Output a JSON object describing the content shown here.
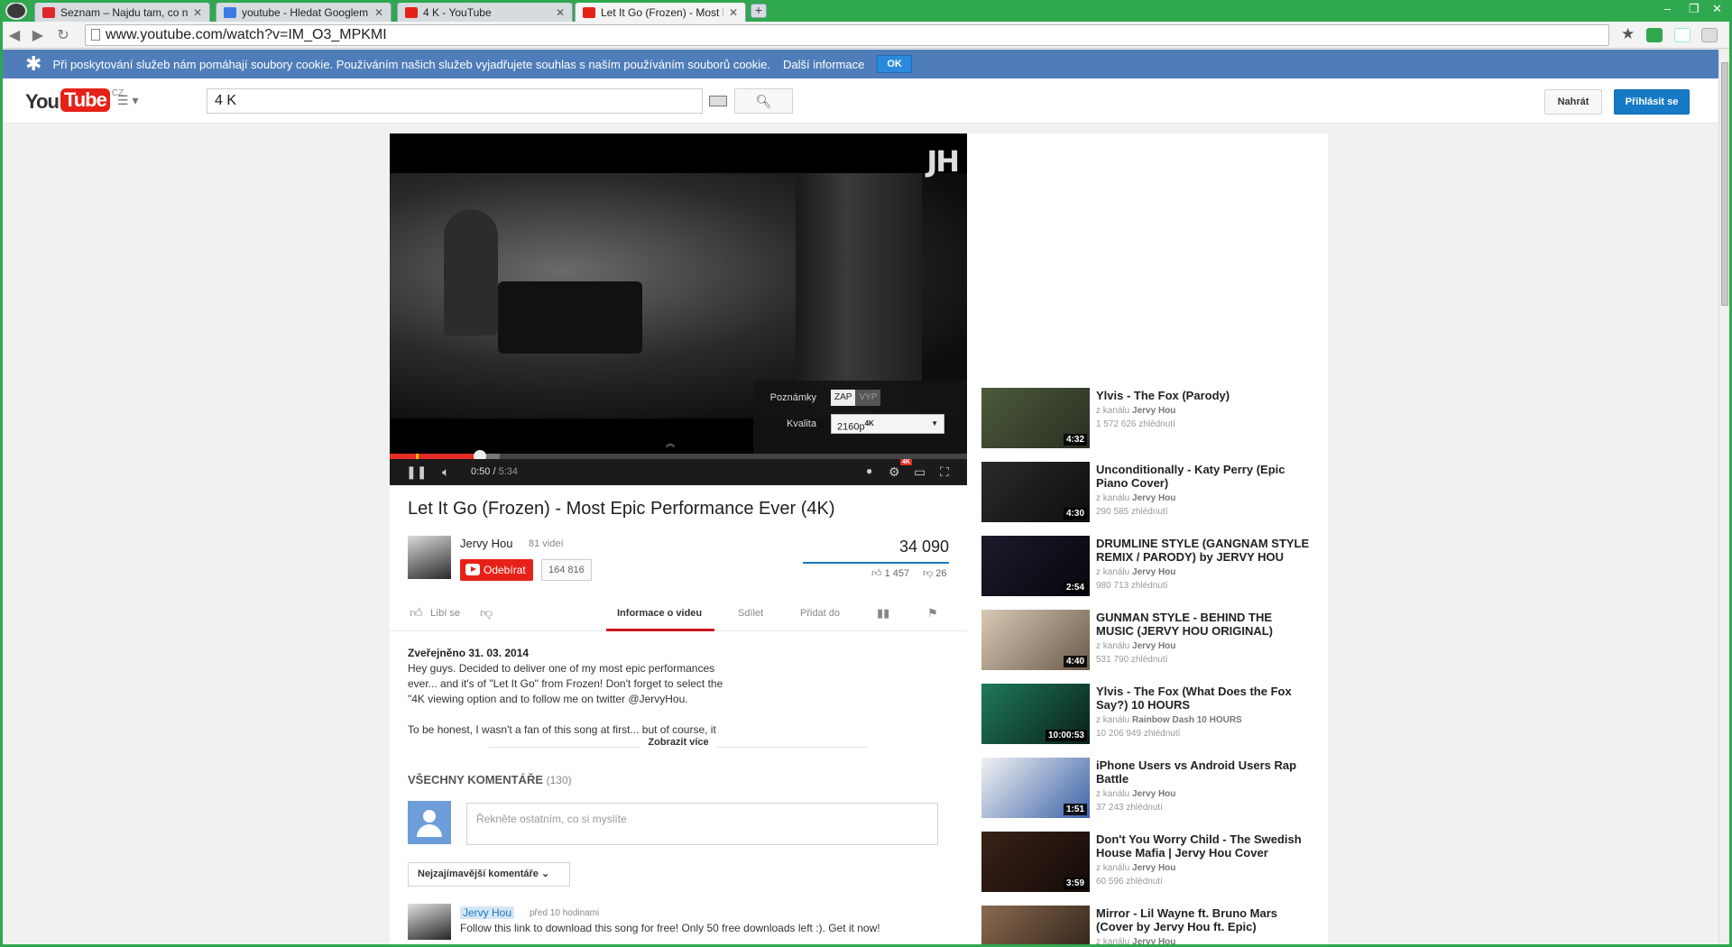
{
  "browser": {
    "tabs": [
      {
        "title": "Seznam – Najdu tam, co nez",
        "favicon_color": "#e0262b"
      },
      {
        "title": "youtube - Hledat Googlem",
        "favicon_color": "#3b7be4"
      },
      {
        "title": "4 K - YouTube",
        "favicon_color": "#e62117"
      },
      {
        "title": "Let It Go (Frozen) - Most Epi",
        "favicon_color": "#e62117",
        "active": true
      }
    ],
    "close_glyph": "✕",
    "new_tab": "+",
    "window_controls": [
      "–",
      "❐",
      "✕"
    ],
    "url": "www.youtube.com/watch?v=IM_O3_MPKMI",
    "frame_color": "#2fa84f"
  },
  "cookie_bar": {
    "message": "Při poskytování služeb nám pomáhají soubory cookie. Používáním našich služeb vyjadřujete souhlas s naším používáním souborů cookie.",
    "more": "Další informace",
    "ok": "OK"
  },
  "header": {
    "logo_you": "You",
    "logo_tube": "Tube",
    "logo_country": "CZ",
    "search_value": "4 K",
    "upload": "Nahrát",
    "signin": "Přihlásit se"
  },
  "player": {
    "watermark": "JH",
    "annotations_label": "Poznámky",
    "annotations_on": "ZAP",
    "annotations_off": "VYP",
    "quality_label": "Kvalita",
    "quality_value": "2160p",
    "quality_badge": "4K",
    "time_current": "0:50",
    "time_total": "5:34",
    "played_fraction": 0.156,
    "buffered_fraction": 0.19,
    "hd_badge": "4K"
  },
  "video": {
    "title": "Let It Go (Frozen) - Most Epic Performance Ever (4K)",
    "channel": "Jervy Hou",
    "channel_videos": "81 videí",
    "subscribe": "Odebírat",
    "subscribers": "164 816",
    "views": "34 090",
    "likes": "1 457",
    "dislikes": "26",
    "like_label": "Líbí se",
    "tabs": [
      "Informace o videu",
      "Sdílet",
      "Přidat do"
    ],
    "published": "Zveřejněno 31. 03. 2014",
    "description_lines": [
      "Hey guys. Decided to deliver one of my most epic performances",
      "ever... and it's of \"Let It Go\" from Frozen! Don't forget to select the",
      "\"4K viewing option and to follow me on twitter @JervyHou.",
      "",
      "To be honest, I wasn't a fan of this song at first... but of course, it"
    ],
    "show_more": "Zobrazit více"
  },
  "comments": {
    "heading": "VŠECHNY KOMENTÁŘE",
    "count": "(130)",
    "placeholder": "Řekněte ostatním, co si myslíte",
    "sort": "Nejzajímavější komentáře",
    "first": {
      "author": "Jervy Hou",
      "time": "před 10 hodinami",
      "text": "Follow this link to download this song for free! Only 50 free downloads left :). Get it now!"
    }
  },
  "sidebar": {
    "channel_prefix": "z kanálu",
    "items": [
      {
        "title": "Ylvis - The Fox (Parody)",
        "channel": "Jervy Hou",
        "views": "1 572 626 zhlédnutí",
        "duration": "4:32",
        "thumb": [
          "#4c5a3a",
          "#2a2f22"
        ]
      },
      {
        "title": "Unconditionally - Katy Perry (Epic Piano Cover)",
        "channel": "Jervy Hou",
        "views": "290 585 zhlédnutí",
        "duration": "4:30",
        "thumb": [
          "#2a2a2a",
          "#0e0e0e"
        ]
      },
      {
        "title": "DRUMLINE STYLE (GANGNAM STYLE REMIX / PARODY) by JERVY HOU",
        "channel": "Jervy Hou",
        "views": "980 713 zhlédnutí",
        "duration": "2:54",
        "thumb": [
          "#1a1a2a",
          "#07070f"
        ]
      },
      {
        "title": "GUNMAN STYLE - BEHIND THE MUSIC (JERVY HOU ORIGINAL)",
        "channel": "Jervy Hou",
        "views": "531 790 zhlédnutí",
        "duration": "4:40",
        "thumb": [
          "#d8c8b4",
          "#6b5a4a"
        ]
      },
      {
        "title": "Ylvis - The Fox (What Does the Fox Say?) 10 HOURS",
        "channel": "Rainbow Dash 10 HOURS",
        "views": "10 206 949 zhlédnutí",
        "duration": "10:00:53",
        "thumb": [
          "#1e7a5a",
          "#0a1f18"
        ]
      },
      {
        "title": "iPhone Users vs Android Users Rap Battle",
        "channel": "Jervy Hou",
        "views": "37 243 zhlédnutí",
        "duration": "1:51",
        "thumb": [
          "#f2f2f2",
          "#3a62a8"
        ]
      },
      {
        "title": "Don't You Worry Child - The Swedish House Mafia | Jervy Hou Cover",
        "channel": "Jervy Hou",
        "views": "60 596 zhlédnutí",
        "duration": "3:59",
        "thumb": [
          "#3a2218",
          "#120a06"
        ]
      },
      {
        "title": "Mirror - Lil Wayne ft. Bruno Mars (Cover by Jervy Hou ft. Epic)",
        "channel": "Jervy Hou",
        "views": "",
        "duration": "",
        "thumb": [
          "#8a6a50",
          "#2a1e14"
        ]
      }
    ]
  }
}
